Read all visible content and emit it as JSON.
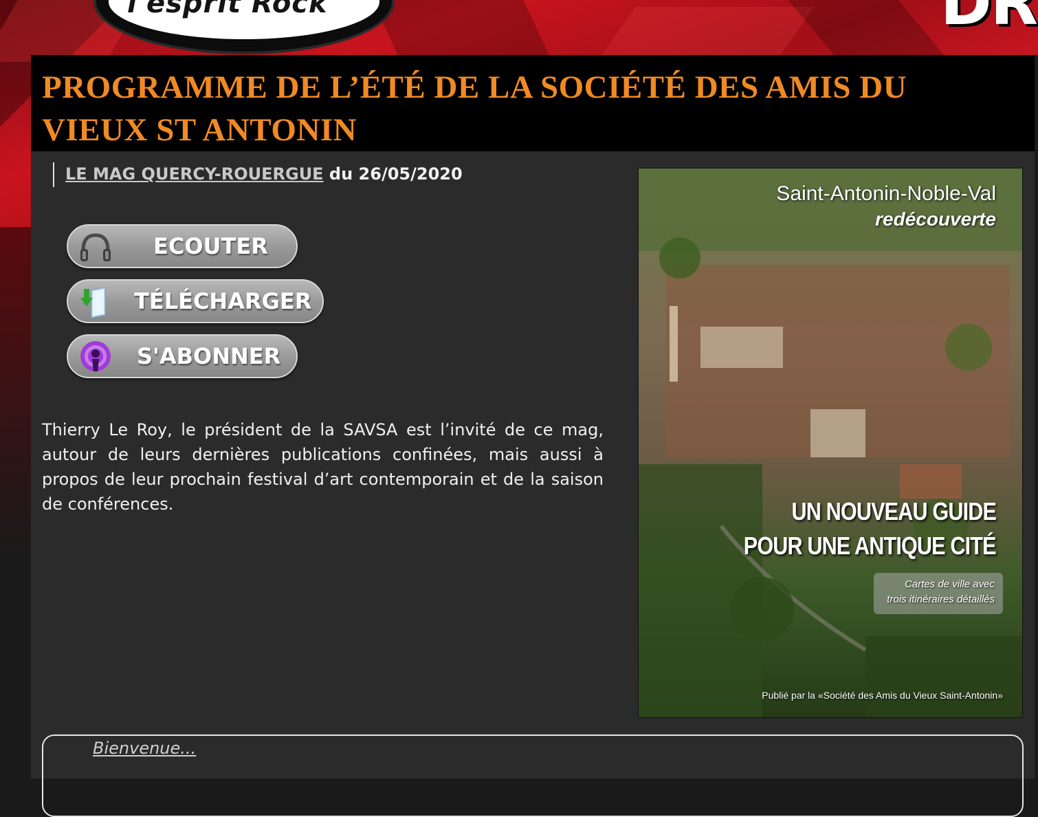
{
  "header": {
    "logo_left_text": "l'esprit Rock",
    "logo_right_text": "DR"
  },
  "article": {
    "title": "PROGRAMME DE L’ÉTÉ DE LA SOCIÉTÉ DES AMIS DU VIEUX ST ANTONIN",
    "source_link": "LE MAG QUERCY-ROUERGUE",
    "date_text": " du 26/05/2020",
    "description": "Thierry Le Roy, le président de la SAVSA est l’invité de ce mag, autour de leurs dernières publications confinées, mais aussi à propos de leur prochain festival d’art contemporain et de la saison de conférences."
  },
  "actions": {
    "listen_label": "ECOUTER",
    "download_label": "TÉLÉCHARGER",
    "subscribe_label": "S'ABONNER"
  },
  "cover": {
    "line1": "Saint-Antonin-Noble-Val",
    "line2": "redécouverte",
    "headline1": "UN NOUVEAU GUIDE",
    "headline2": "POUR UNE ANTIQUE CITÉ",
    "badge1": "Cartes de ville avec",
    "badge2": "trois itinéraires détaillés",
    "footer": "Publié par la «Société des Amis du Vieux Saint-Antonin»"
  },
  "footer_box": {
    "welcome_link": "Bienvenue..."
  },
  "colors": {
    "title_orange": "#f08a24",
    "banner_red": "#c8141e",
    "panel_bg": "#2b2b2b"
  }
}
